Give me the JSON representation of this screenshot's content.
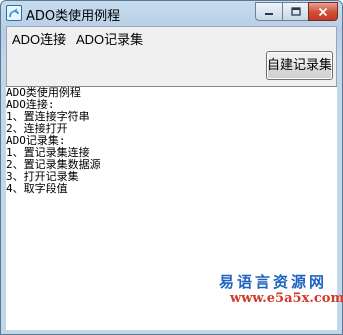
{
  "window": {
    "title": "ADO类使用例程",
    "controls": {
      "minimize": "minimize-icon",
      "maximize": "maximize-icon",
      "close": "close-icon"
    }
  },
  "menu": {
    "items": [
      {
        "label": "ADO连接"
      },
      {
        "label": "ADO记录集"
      }
    ]
  },
  "toolbar": {
    "create_recordset_label": "自建记录集"
  },
  "output": {
    "lines": [
      "ADO类使用例程",
      "ADO连接:",
      "1、置连接字符串",
      "2、连接打开",
      "ADO记录集:",
      "1、置记录集连接",
      "2、置记录集数据源",
      "3、打开记录集",
      "4、取字段值"
    ]
  },
  "watermark": {
    "brand": "易语言资源网",
    "url": "www.e5a5x.com"
  },
  "colors": {
    "frame": "#b6cee6",
    "close_button": "#c13b21",
    "watermark_brand": "#1e63c0",
    "watermark_url": "#d43a2a"
  }
}
